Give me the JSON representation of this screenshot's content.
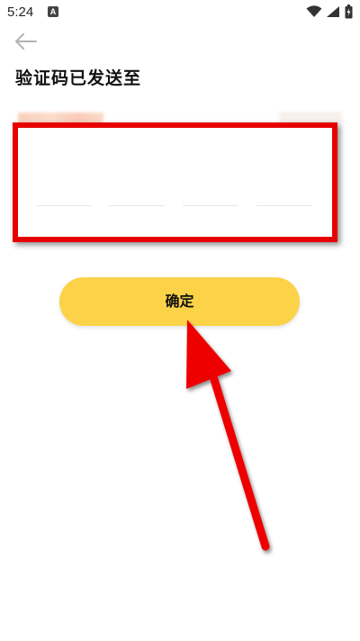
{
  "status_bar": {
    "time": "5:24",
    "notification_glyph": "A",
    "icons": [
      "wifi-icon",
      "signal-icon",
      "battery-icon"
    ]
  },
  "header": {
    "back_icon": "back-arrow-icon",
    "title": "验证码已发送至"
  },
  "code_input": {
    "cells": [
      "",
      "",
      "",
      ""
    ]
  },
  "confirm_button": {
    "label": "确定"
  },
  "colors": {
    "accent_button": "#fcd348",
    "annotation_red": "#e60000"
  }
}
